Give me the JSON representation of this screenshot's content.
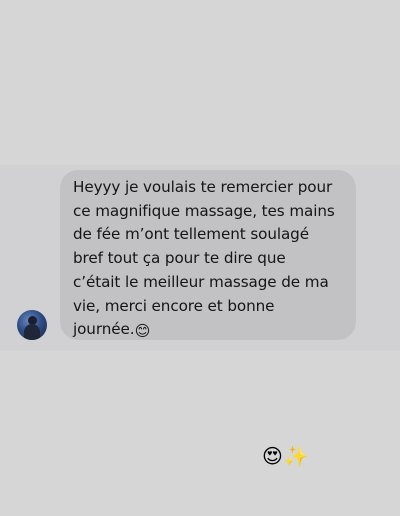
{
  "message": {
    "lines": [
      "Heyyy je voulais te remercier pour",
      "ce magnifique massage, tes mains",
      "de fée m’ont tellement soulagé",
      "bref tout ça pour te dire que",
      "c’était le meilleur massage de ma",
      "vie, merci encore et bonne",
      "journée."
    ],
    "trailing_emoji": "😊"
  },
  "reaction": {
    "emoji_1": "😍",
    "emoji_2": "✨"
  },
  "colors": {
    "background": "#d6d6d7",
    "bubble": "#c2c2c5",
    "text": "#151515"
  },
  "icons": {
    "avatar": "contact-avatar"
  }
}
